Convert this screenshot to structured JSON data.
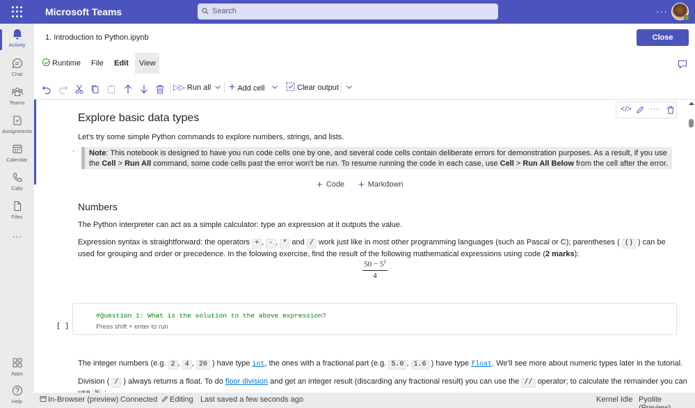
{
  "app": {
    "name": "Microsoft Teams",
    "search_placeholder": "Search",
    "more": "···"
  },
  "rail": [
    {
      "label": "Activity",
      "icon": "bell-icon",
      "active": true
    },
    {
      "label": "Chat",
      "icon": "chat-icon"
    },
    {
      "label": "Teams",
      "icon": "teams-icon"
    },
    {
      "label": "Assignments",
      "icon": "assignments-icon"
    },
    {
      "label": "Calendar",
      "icon": "calendar-icon"
    },
    {
      "label": "Calls",
      "icon": "phone-icon"
    },
    {
      "label": "Files",
      "icon": "file-icon"
    },
    {
      "label": "···",
      "icon": "more-icon"
    },
    {
      "label": "Apps",
      "icon": "apps-icon"
    },
    {
      "label": "Help",
      "icon": "help-icon"
    }
  ],
  "file": {
    "title": "1. Introduction to Python.ipynb",
    "close_label": "Close"
  },
  "menu": {
    "runtime": "Runtime",
    "file": "File",
    "edit": "Edit",
    "view": "View"
  },
  "toolbar": {
    "run_all": "Run all",
    "add_cell": "Add cell",
    "clear_output": "Clear output"
  },
  "notebook": {
    "h1": "Explore basic data types",
    "intro": "Let's try some simple Python commands to explore numbers, strings, and lists.",
    "note_marker": "ʿ",
    "note": {
      "label": "Note",
      "text1": ": This notebook is designed to have you run code cells one by one, and several code cells contain deliberate errors for demonstration purposes. As a result, if you use the ",
      "cell": "Cell",
      "gt": " > ",
      "run_all": "Run All",
      "text2": " command, some code cells past the error won't be run. To resume running the code in each case, use ",
      "cell2": "Cell",
      "gt2": " > ",
      "run_all_below": "Run All Below",
      "text3": " from the cell after the error."
    },
    "add_code": "Code",
    "add_markdown": "Markdown",
    "h2": "Numbers",
    "p1": "The Python interpreter can act as a simple calculator: type an expression at it outputs the value.",
    "p2": {
      "t1": "Expression syntax is straightforward: the operators ",
      "op1": "+",
      "c1": ", ",
      "op2": "-",
      "c2": ", ",
      "op3": "*",
      "and": " and ",
      "op4": "/",
      "t2": " work just like in most other programming languages (such as Pascal or C); parentheses ( ",
      "paren": "()",
      "t3": " ) can be used for grouping and order or precedence. In the folowing exercise, find the result of the following mathematical expressions using code (",
      "marks": "2 marks",
      "t4": "):"
    },
    "formula": {
      "numerator": "50 − 5",
      "exp": "2",
      "denominator": "4"
    },
    "code_cell": {
      "prompt": "[ ]",
      "code": "#Question 1: What is the solution to the above expression?",
      "hint": "Press shift + enter to run"
    },
    "p3": {
      "t1": "The integer numbers (e.g. ",
      "n1": "2",
      "c1": ", ",
      "n2": "4",
      "c2": ", ",
      "n3": "20",
      "t2": " ) have type ",
      "int": "int",
      "t3": ", the ones with a fractional part (e.g. ",
      "f1": "5.0",
      "c3": ", ",
      "f2": "1.6",
      "t4": " ) have type ",
      "float": "float",
      "t5": ". We'll see more about numeric types later in the tutorial."
    },
    "p4": {
      "t1": "Division ( ",
      "div": "/",
      "t2": " ) always returns a float. To do ",
      "floor": "floor division",
      "t3": " and get an integer result (discarding any fractional result) you can use the ",
      "fdiv": "//",
      "t4": " operator; to calculate the remainder you can use ",
      "mod": "%",
      "t5": " :"
    }
  },
  "status": {
    "in_browser": "In-Browser (preview)",
    "connected": "Connected",
    "editing": "Editing",
    "saved": "Last saved a few seconds ago",
    "kernel": "Kernel Idle",
    "pyolite": "Pyolite (Preview)"
  },
  "colors": {
    "brand": "#4b53bc",
    "link": "#0078d4",
    "comment": "#008000"
  }
}
